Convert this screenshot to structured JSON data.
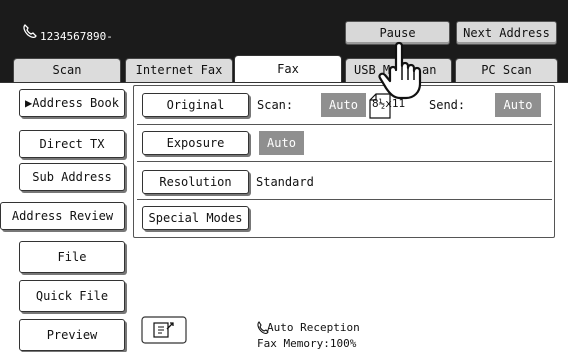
{
  "status_bar": {
    "phone_number": "1234567890-",
    "pause_label": "Pause",
    "next_address_label": "Next Address"
  },
  "tabs": [
    {
      "label": "Scan"
    },
    {
      "label": "Internet Fax"
    },
    {
      "label": "Fax"
    },
    {
      "label": "USB M",
      "label_tail": "an"
    },
    {
      "label": "PC Scan"
    }
  ],
  "sidebar": {
    "address_book": "▶Address Book",
    "direct_tx": "Direct TX",
    "sub_address": "Sub Address",
    "address_review": "Address Review",
    "file": "File",
    "quick_file": "Quick File",
    "preview": "Preview"
  },
  "settings": {
    "original_label": "Original",
    "scan_label": "Scan:",
    "scan_value": "Auto",
    "paper_size": "8½x11",
    "send_label": "Send:",
    "send_value": "Auto",
    "exposure_label": "Exposure",
    "exposure_value": "Auto",
    "resolution_label": "Resolution",
    "resolution_value": "Standard",
    "special_modes_label": "Special Modes"
  },
  "status": {
    "reception": "Auto Reception",
    "memory": "Fax Memory:100%"
  }
}
